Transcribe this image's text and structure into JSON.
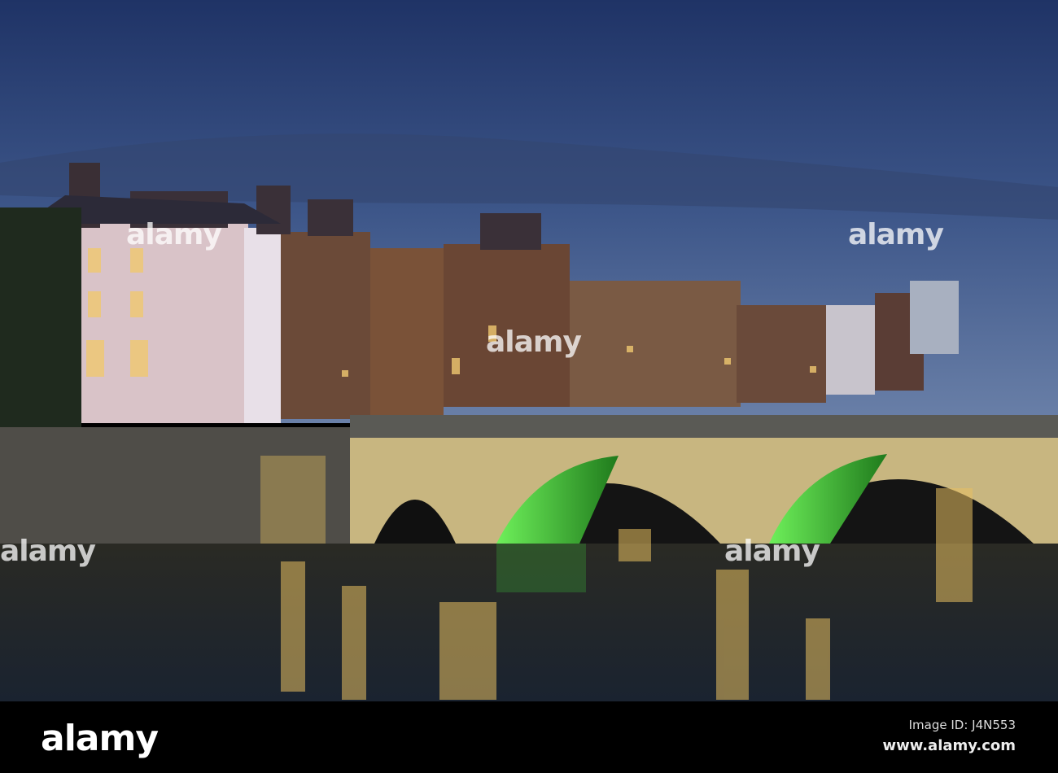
{
  "watermark": {
    "text": "alamy"
  },
  "footer": {
    "logo": "alamy",
    "image_id": "Image ID: J4N553",
    "website": "www.alamy.com"
  },
  "colors": {
    "sky_top": "#2a3f73",
    "sky_bottom": "#56709e",
    "bridge_light": "#e8d38a",
    "arch_green": "#3fcf3a",
    "water": "#1c2430"
  }
}
